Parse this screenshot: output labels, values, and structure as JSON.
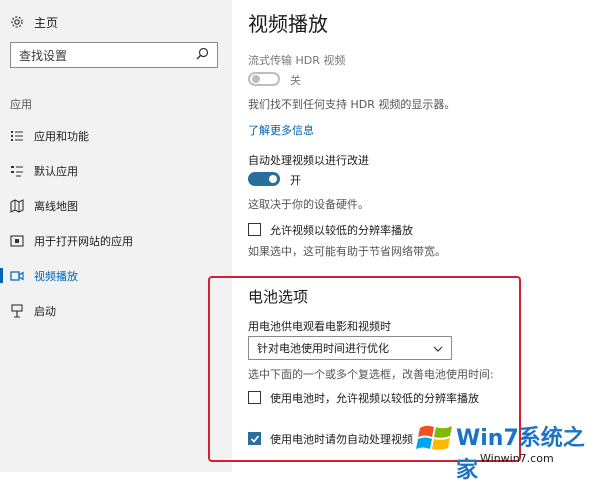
{
  "sidebar": {
    "home_label": "主页",
    "search_placeholder": "查找设置",
    "section_label": "应用",
    "items": [
      {
        "label": "应用和功能",
        "icon": "list-icon",
        "active": false
      },
      {
        "label": "默认应用",
        "icon": "default-apps-icon",
        "active": false
      },
      {
        "label": "离线地图",
        "icon": "map-icon",
        "active": false
      },
      {
        "label": "用于打开网站的应用",
        "icon": "open-web-icon",
        "active": false
      },
      {
        "label": "视频播放",
        "icon": "video-icon",
        "active": true
      },
      {
        "label": "启动",
        "icon": "startup-icon",
        "active": false
      }
    ]
  },
  "main": {
    "title": "视频播放",
    "hdr_label": "流式传输 HDR 视频",
    "hdr_toggle_state": "关",
    "hdr_desc": "我们找不到任何支持 HDR 视频的显示器。",
    "learn_more": "了解更多信息",
    "auto_process_label": "自动处理视频以进行改进",
    "auto_process_toggle_state": "开",
    "auto_process_desc": "这取决于你的设备硬件。",
    "low_res_label": "允许视频以较低的分辨率播放",
    "low_res_desc": "如果选中，这可能有助于节省网络带宽。"
  },
  "battery": {
    "title": "电池选项",
    "watch_label": "用电池供电观看电影和视频时",
    "dropdown_value": "针对电池使用时间进行优化",
    "select_hint": "选中下面的一个或多个复选框，改善电池使用时间:",
    "option1_label": "使用电池时，允许视频以较低的分辨率播放",
    "option2_label": "使用电池时请勿自动处理视频"
  },
  "watermark": {
    "brand": "Win7系统之家",
    "url": "Winwin7.com"
  },
  "colors": {
    "accent": "#0063b1",
    "toggle_on": "#2a6e9c",
    "highlight_border": "#d2202f"
  }
}
